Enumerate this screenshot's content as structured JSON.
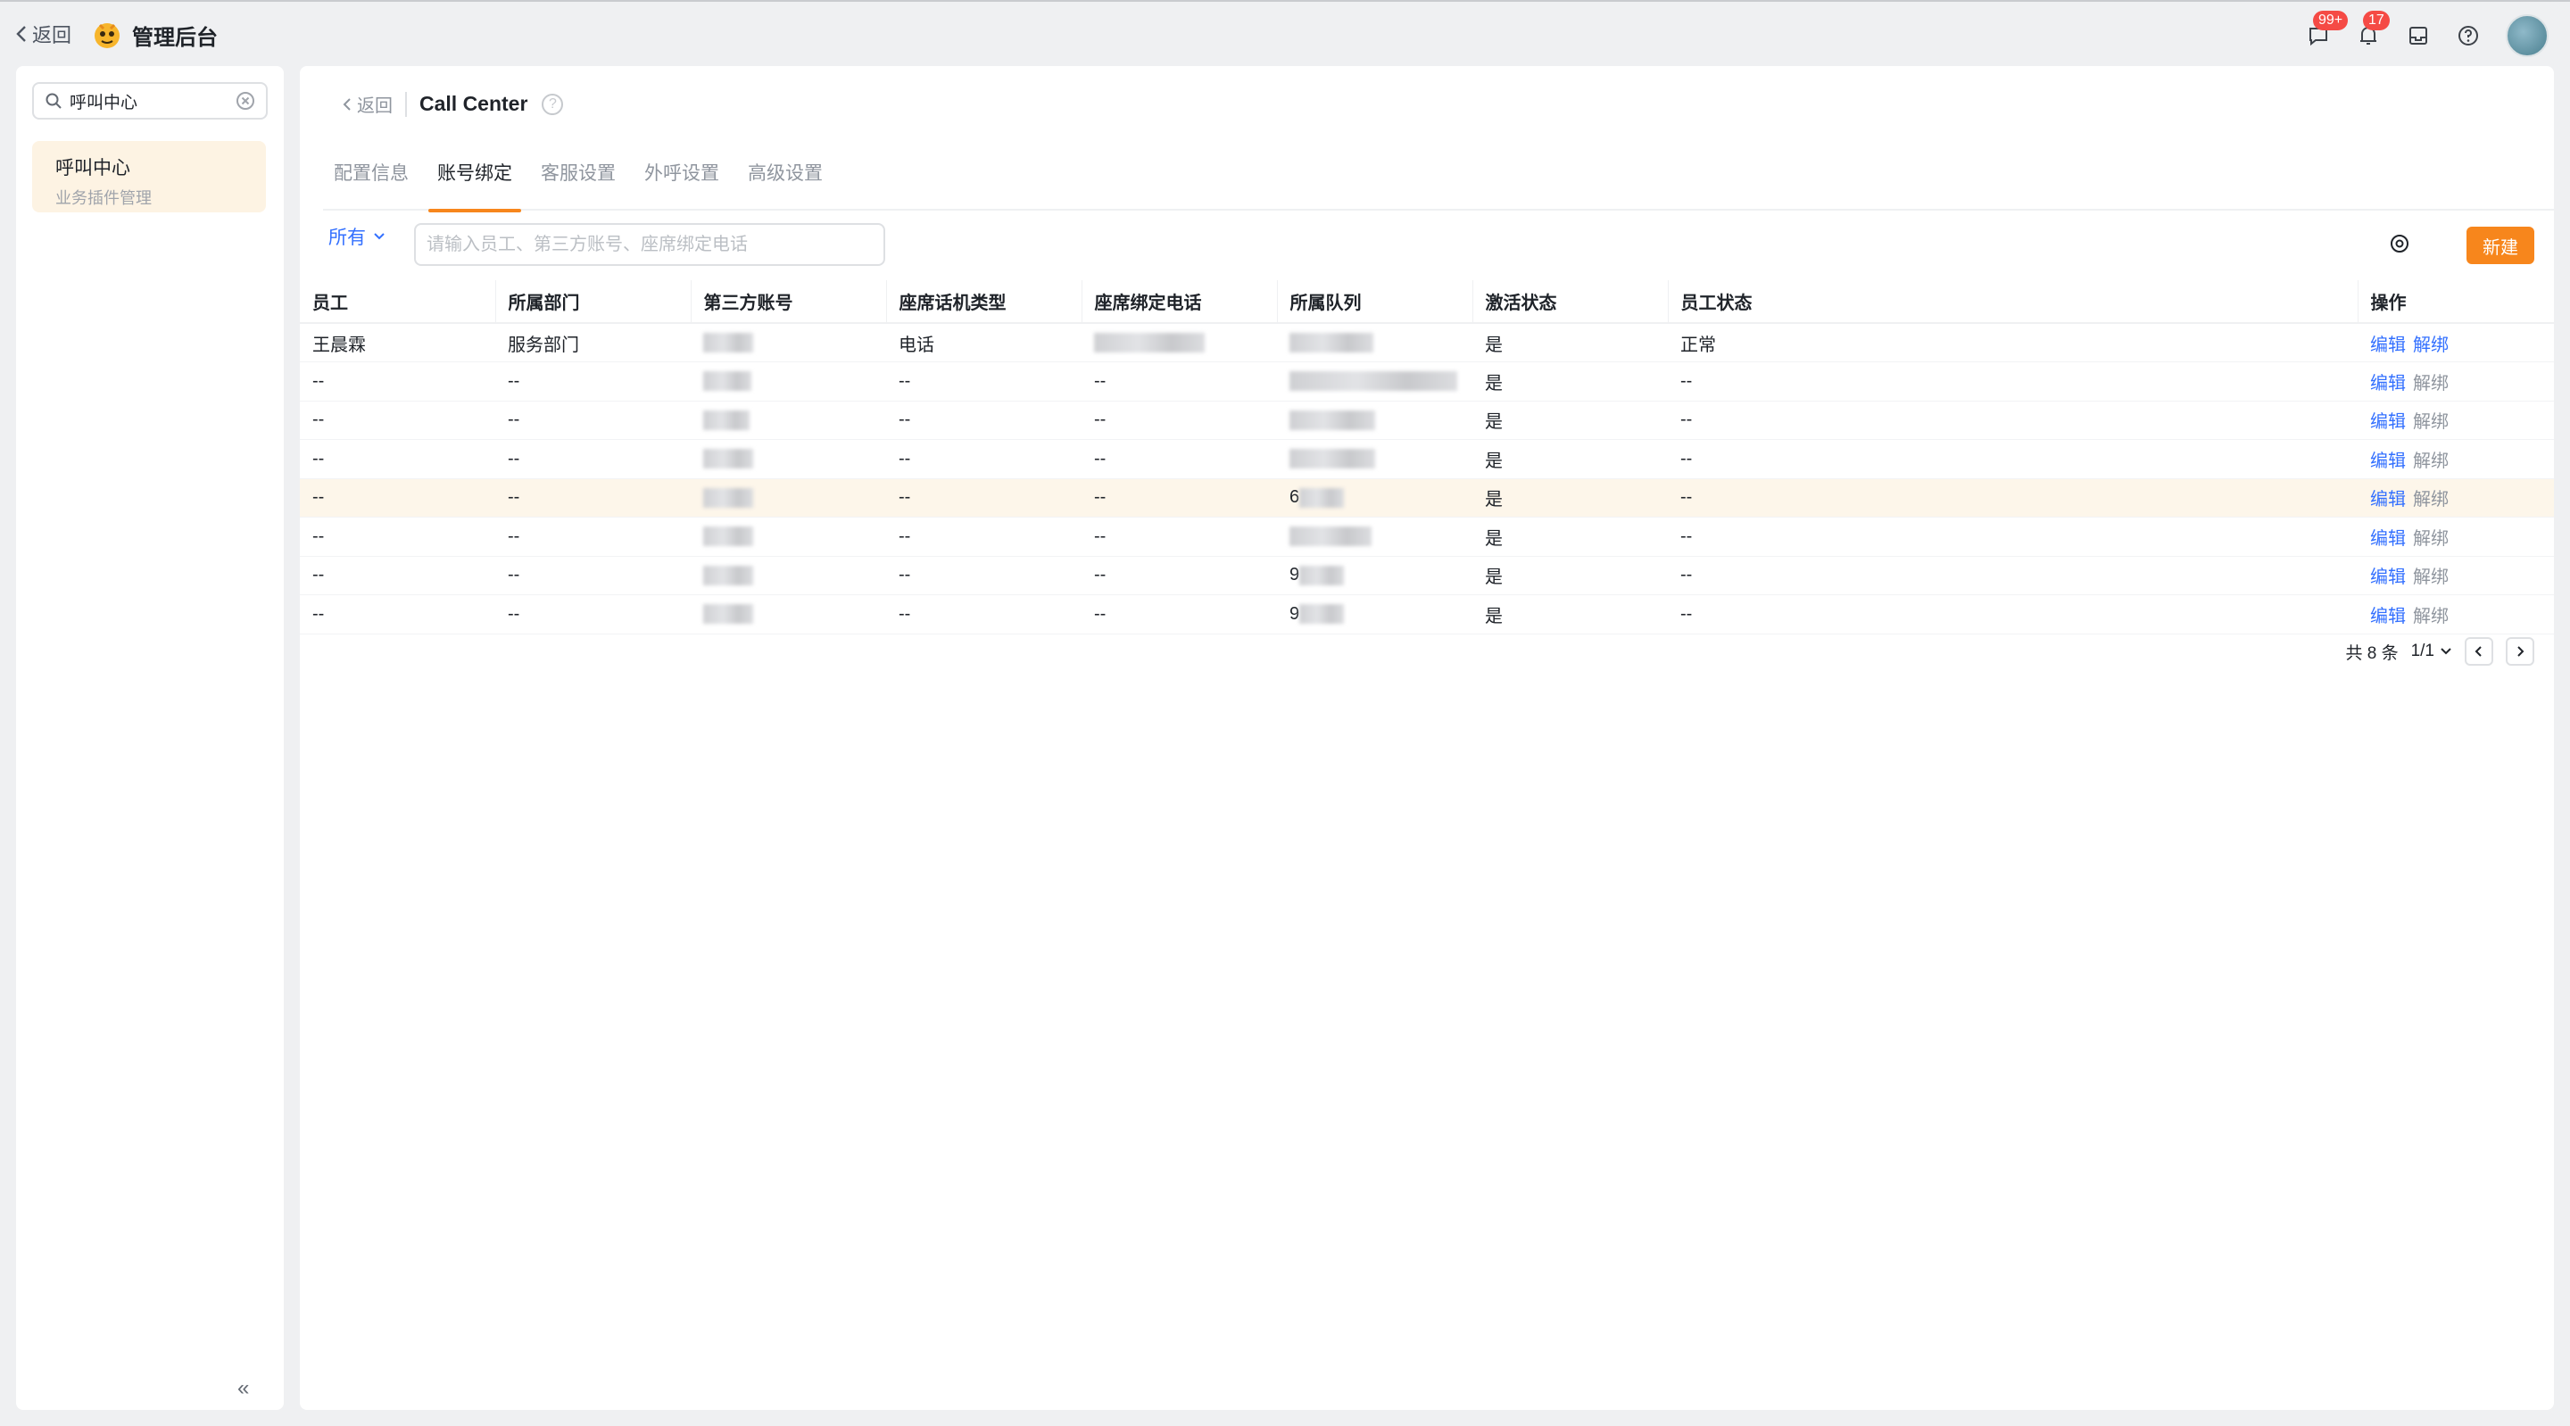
{
  "topbar": {
    "back_label": "返回",
    "app_title": "管理后台",
    "chat_badge": "99+",
    "bell_badge": "17"
  },
  "sidebar": {
    "search_value": "呼叫中心",
    "item": {
      "title": "呼叫中心",
      "subtitle": "业务插件管理"
    },
    "collapse_label": "«"
  },
  "breadcrumb": {
    "back_label": "返回",
    "title": "Call Center"
  },
  "tabs": [
    "配置信息",
    "账号绑定",
    "客服设置",
    "外呼设置",
    "高级设置"
  ],
  "active_tab": 1,
  "toolbar": {
    "filter_label": "所有",
    "search_placeholder": "请输入员工、第三方账号、座席绑定电话",
    "new_label": "新建"
  },
  "table": {
    "columns": [
      "员工",
      "所属部门",
      "第三方账号",
      "座席话机类型",
      "座席绑定电话",
      "所属队列",
      "激活状态",
      "员工状态",
      "操作"
    ],
    "rows": [
      {
        "employee": "王晨霖",
        "dept": "服务部门",
        "phone_type": "电话",
        "active": "是",
        "status": "正常",
        "queue_prefix": ""
      },
      {
        "employee": "--",
        "dept": "--",
        "phone_type": "--",
        "active": "是",
        "status": "--",
        "queue_prefix": ""
      },
      {
        "employee": "--",
        "dept": "--",
        "phone_type": "--",
        "active": "是",
        "status": "--",
        "queue_prefix": ""
      },
      {
        "employee": "--",
        "dept": "--",
        "phone_type": "--",
        "active": "是",
        "status": "--",
        "queue_prefix": ""
      },
      {
        "employee": "--",
        "dept": "--",
        "phone_type": "--",
        "active": "是",
        "status": "--",
        "queue_prefix": "6"
      },
      {
        "employee": "--",
        "dept": "--",
        "phone_type": "--",
        "active": "是",
        "status": "--",
        "queue_prefix": ""
      },
      {
        "employee": "--",
        "dept": "--",
        "phone_type": "--",
        "active": "是",
        "status": "--",
        "queue_prefix": "9"
      },
      {
        "employee": "--",
        "dept": "--",
        "phone_type": "--",
        "active": "是",
        "status": "--",
        "queue_prefix": "9"
      }
    ],
    "edit_label": "编辑",
    "unbind_label": "解绑"
  },
  "pagination": {
    "total": "共 8 条",
    "page": "1/1"
  },
  "colors": {
    "accent": "#f7861c",
    "link": "#3370ff",
    "highlight_row": "#fdf6ea"
  }
}
